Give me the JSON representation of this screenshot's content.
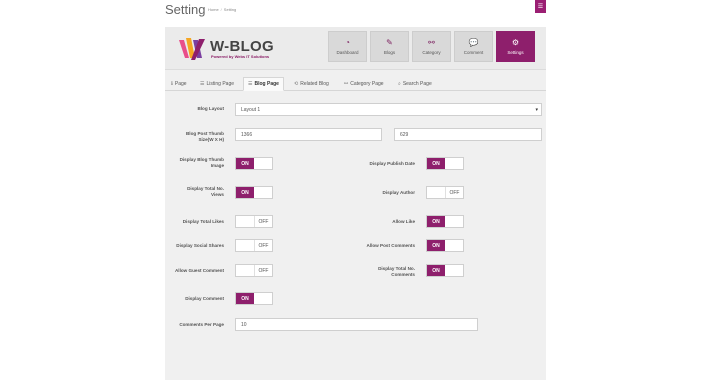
{
  "page": {
    "title": "Setting",
    "breadcrumb": [
      "Home",
      "Setting"
    ]
  },
  "header": {
    "logo": {
      "word": "W-BLOG",
      "tagline": "Powered by Webs IT Solutions"
    },
    "tiles": [
      {
        "label": "Dashboard",
        "icon": "dashboard-icon",
        "glyph": "◔"
      },
      {
        "label": "Blogs",
        "icon": "edit-icon",
        "glyph": "✎"
      },
      {
        "label": "Category",
        "icon": "link-icon",
        "glyph": "⚯"
      },
      {
        "label": "Comment",
        "icon": "comment-icon",
        "glyph": "💬"
      },
      {
        "label": "Settings",
        "icon": "gear-icon",
        "glyph": "⚙",
        "active": true
      }
    ]
  },
  "tabs": [
    {
      "label": "Page",
      "glyph": "ℹ"
    },
    {
      "label": "Listing Page",
      "glyph": "☰"
    },
    {
      "label": "Blog Page",
      "glyph": "☰",
      "active": true
    },
    {
      "label": "Related Blog",
      "glyph": "⟲"
    },
    {
      "label": "Category Page",
      "glyph": "⚯"
    },
    {
      "label": "Search Page",
      "glyph": "⌕"
    }
  ],
  "form": {
    "blog_layout": {
      "label": "Blog Layout",
      "value": "Layout 1"
    },
    "thumb_size": {
      "label": "Blog Post Thumb Size(W X H)",
      "width": "1366",
      "height": "629"
    },
    "toggles": {
      "display_thumb": {
        "label": "Display Blog Thumb Image",
        "on": true,
        "on_text": "ON",
        "off_text": "OFF"
      },
      "display_publish_date": {
        "label": "Display Publish Date",
        "on": true,
        "on_text": "ON",
        "off_text": "OFF"
      },
      "display_total_views": {
        "label": "Display Total No. Views",
        "on": true,
        "on_text": "ON",
        "off_text": "OFF"
      },
      "display_author": {
        "label": "Display Author",
        "on": false,
        "on_text": "ON",
        "off_text": "OFF"
      },
      "display_total_likes": {
        "label": "Display Total Likes",
        "on": false,
        "on_text": "ON",
        "off_text": "OFF"
      },
      "allow_like": {
        "label": "Allow Like",
        "on": true,
        "on_text": "ON",
        "off_text": "OFF"
      },
      "display_social_shares": {
        "label": "Display Social Shares",
        "on": false,
        "on_text": "ON",
        "off_text": "OFF"
      },
      "allow_post_comments": {
        "label": "Allow Post Comments",
        "on": true,
        "on_text": "ON",
        "off_text": "OFF"
      },
      "allow_guest_comment": {
        "label": "Allow Guest Comment",
        "on": false,
        "on_text": "ON",
        "off_text": "OFF"
      },
      "display_total_comments": {
        "label": "Display Total No. Comments",
        "on": true,
        "on_text": "ON",
        "off_text": "OFF"
      },
      "display_comment": {
        "label": "Display Comment",
        "on": true,
        "on_text": "ON",
        "off_text": "OFF"
      }
    },
    "comments_per_page": {
      "label": "Comments Per Page",
      "value": "10"
    }
  },
  "colors": {
    "accent": "#8e1f6c",
    "panel": "#f0f0f0"
  }
}
